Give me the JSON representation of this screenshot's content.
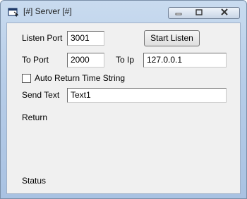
{
  "window": {
    "title": "[#] Server [#]",
    "controls": [
      "minimize-icon",
      "maximize-icon",
      "close-icon"
    ]
  },
  "form": {
    "listen_port_label": "Listen Port",
    "listen_port_value": "3001",
    "start_listen_label": "Start Listen",
    "to_port_label": "To Port",
    "to_port_value": "2000",
    "to_ip_label": "To Ip",
    "to_ip_value": "127.0.0.1",
    "auto_return_label": "Auto Return Time String",
    "auto_return_checked": false,
    "send_text_label": "Send Text",
    "send_text_value": "Text1",
    "return_label": "Return",
    "status_label": "Status"
  },
  "colors": {
    "frame": "#b7cde8",
    "client_bg": "#f0f0f0"
  }
}
